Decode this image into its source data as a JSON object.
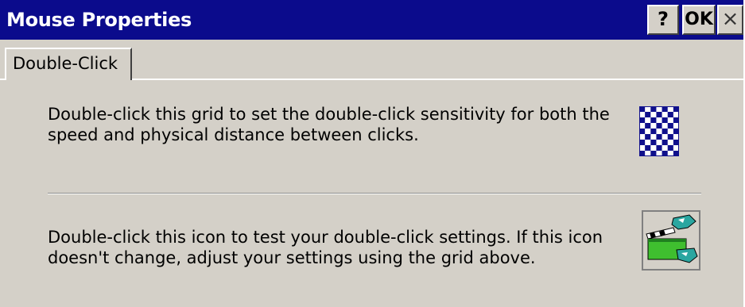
{
  "window": {
    "title": "Mouse Properties",
    "help_label": "?",
    "ok_label": "OK",
    "close_label": "×"
  },
  "tabs": [
    {
      "label": "Double-Click",
      "selected": true
    }
  ],
  "double_click": {
    "grid_instruction": "Double-click this grid to set the double-click sensitivity for both the speed and physical distance between clicks.",
    "test_instruction": "Double-click this icon to test your double-click settings. If this icon doesn't change, adjust your settings using the grid above."
  },
  "colors": {
    "titlebar": "#0b0b8c",
    "face": "#d4d0c8",
    "grid_blue": "#10108c",
    "icon_green": "#3fbf2f"
  }
}
